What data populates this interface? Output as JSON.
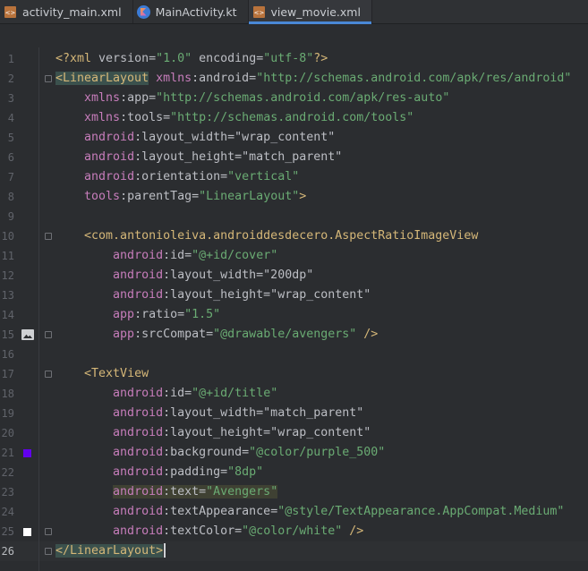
{
  "tabs": [
    {
      "label": "activity_main.xml",
      "icon": "xml-file-icon",
      "active": false
    },
    {
      "label": "MainActivity.kt",
      "icon": "kotlin-file-icon",
      "active": false
    },
    {
      "label": "view_movie.xml",
      "icon": "xml-file-icon",
      "active": true
    }
  ],
  "editor": {
    "current_line": 26,
    "lines": [
      {
        "n": "1",
        "text": "<?xml version=\"1.0\" encoding=\"utf-8\"?>"
      },
      {
        "n": "2",
        "text": "<LinearLayout xmlns:android=\"http://schemas.android.com/apk/res/android\""
      },
      {
        "n": "3",
        "text": "    xmlns:app=\"http://schemas.android.com/apk/res-auto\""
      },
      {
        "n": "4",
        "text": "    xmlns:tools=\"http://schemas.android.com/tools\""
      },
      {
        "n": "5",
        "text": "    android:layout_width=\"wrap_content\""
      },
      {
        "n": "6",
        "text": "    android:layout_height=\"match_parent\""
      },
      {
        "n": "7",
        "text": "    android:orientation=\"vertical\""
      },
      {
        "n": "8",
        "text": "    tools:parentTag=\"LinearLayout\">"
      },
      {
        "n": "9",
        "text": ""
      },
      {
        "n": "10",
        "text": "    <com.antonioleiva.androiddesdecero.AspectRatioImageView"
      },
      {
        "n": "11",
        "text": "        android:id=\"@+id/cover\""
      },
      {
        "n": "12",
        "text": "        android:layout_width=\"200dp\""
      },
      {
        "n": "13",
        "text": "        android:layout_height=\"wrap_content\""
      },
      {
        "n": "14",
        "text": "        app:ratio=\"1.5\""
      },
      {
        "n": "15",
        "text": "        app:srcCompat=\"@drawable/avengers\" />"
      },
      {
        "n": "16",
        "text": ""
      },
      {
        "n": "17",
        "text": "    <TextView"
      },
      {
        "n": "18",
        "text": "        android:id=\"@+id/title\""
      },
      {
        "n": "19",
        "text": "        android:layout_width=\"match_parent\""
      },
      {
        "n": "20",
        "text": "        android:layout_height=\"wrap_content\""
      },
      {
        "n": "21",
        "text": "        android:background=\"@color/purple_500\""
      },
      {
        "n": "22",
        "text": "        android:padding=\"8dp\""
      },
      {
        "n": "23",
        "text": "        android:text=\"Avengers\""
      },
      {
        "n": "24",
        "text": "        android:textAppearance=\"@style/TextAppearance.AppCompat.Medium\""
      },
      {
        "n": "25",
        "text": "        android:textColor=\"@color/white\" />"
      },
      {
        "n": "26",
        "text": "</LinearLayout>"
      }
    ]
  },
  "gutter": {
    "line15_icon": "image-preview-icon",
    "line21_color": "#6200ee",
    "line25_color": "#ffffff"
  },
  "colors": {
    "tag": "#d5b778",
    "namespace": "#c77dbb",
    "string": "#6aab73",
    "text": "#bcbec4",
    "background": "#2b2d30",
    "tab_accent": "#4a88d6"
  }
}
